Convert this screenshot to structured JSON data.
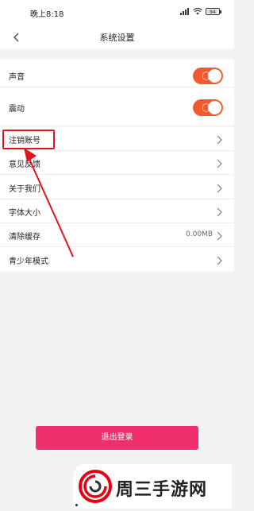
{
  "status_bar": {
    "time": "晚上8:18",
    "battery": "94",
    "icons": [
      "signal-icon",
      "wifi-icon",
      "battery-icon"
    ]
  },
  "header": {
    "title": "系统设置",
    "back_icon": "chevron-left-icon"
  },
  "toggles": [
    {
      "label": "声音",
      "state": "on"
    },
    {
      "label": "震动",
      "state": "on"
    }
  ],
  "menu_items": [
    {
      "label": "注销账号",
      "value": ""
    },
    {
      "label": "意见反馈",
      "value": ""
    },
    {
      "label": "关于我们",
      "value": ""
    },
    {
      "label": "字体大小",
      "value": ""
    },
    {
      "label": "清除缓存",
      "value": "0.00MB"
    },
    {
      "label": "青少年模式",
      "value": ""
    }
  ],
  "logout": {
    "label": "退出登录"
  },
  "watermark": {
    "text": "周三手游网"
  },
  "colors": {
    "toggle_on": "#f15a2e",
    "logout_button": "#f0306d",
    "highlight": "#e3141c",
    "background": "#f2f2f2"
  }
}
